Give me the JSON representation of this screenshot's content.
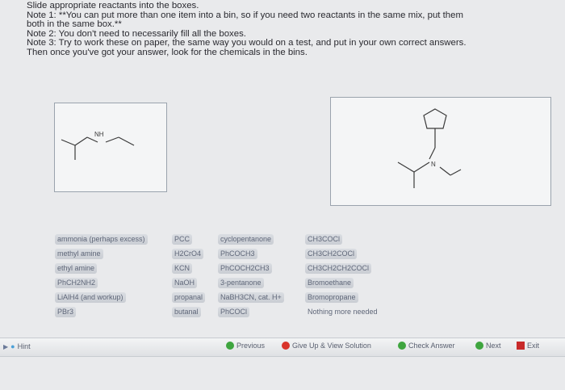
{
  "instructions": {
    "line1": "Slide appropriate reactants into the boxes.",
    "line2": "Note 1: **You can put more than one item into a bin, so if you need two reactants in the same mix, put them",
    "line3": "both in the same box.**",
    "line4": "Note 2: You don't need to necessarily fill all the boxes.",
    "line5": "Note 3: Try to work these on paper, the same way you would on a test, and put in your own correct answers.",
    "line6": "Then once you've got your answer, look for the chemicals in the bins."
  },
  "molecule1": {
    "atom_label": "NH"
  },
  "molecule2": {
    "atom_label": "N"
  },
  "reagents": {
    "col1": [
      "ammonia (perhaps excess)",
      "methyl amine",
      "ethyl amine",
      "PhCH2NH2",
      "LiAlH4 (and workup)",
      "PBr3"
    ],
    "col2": [
      "PCC",
      "H2CrO4",
      "KCN",
      "NaOH",
      "propanal",
      "butanal"
    ],
    "col3": [
      "cyclopentanone",
      "PhCOCH3",
      "PhCOCH2CH3",
      "3-pentanone",
      "NaBH3CN, cat. H+",
      "PhCOCl"
    ],
    "col4": [
      "CH3COCl",
      "CH3CH2COCl",
      "CH3CH2CH2COCl",
      "Bromoethane",
      "Bromopropane",
      "Nothing more needed"
    ]
  },
  "footer": {
    "hint": "Hint",
    "previous": "Previous",
    "give_up": "Give Up & View Solution",
    "check": "Check Answer",
    "next": "Next",
    "exit": "Exit"
  },
  "colors": {
    "accent_green": "#3fa53f",
    "give_up_red": "#d9342b",
    "exit_red": "#c82a2a"
  }
}
